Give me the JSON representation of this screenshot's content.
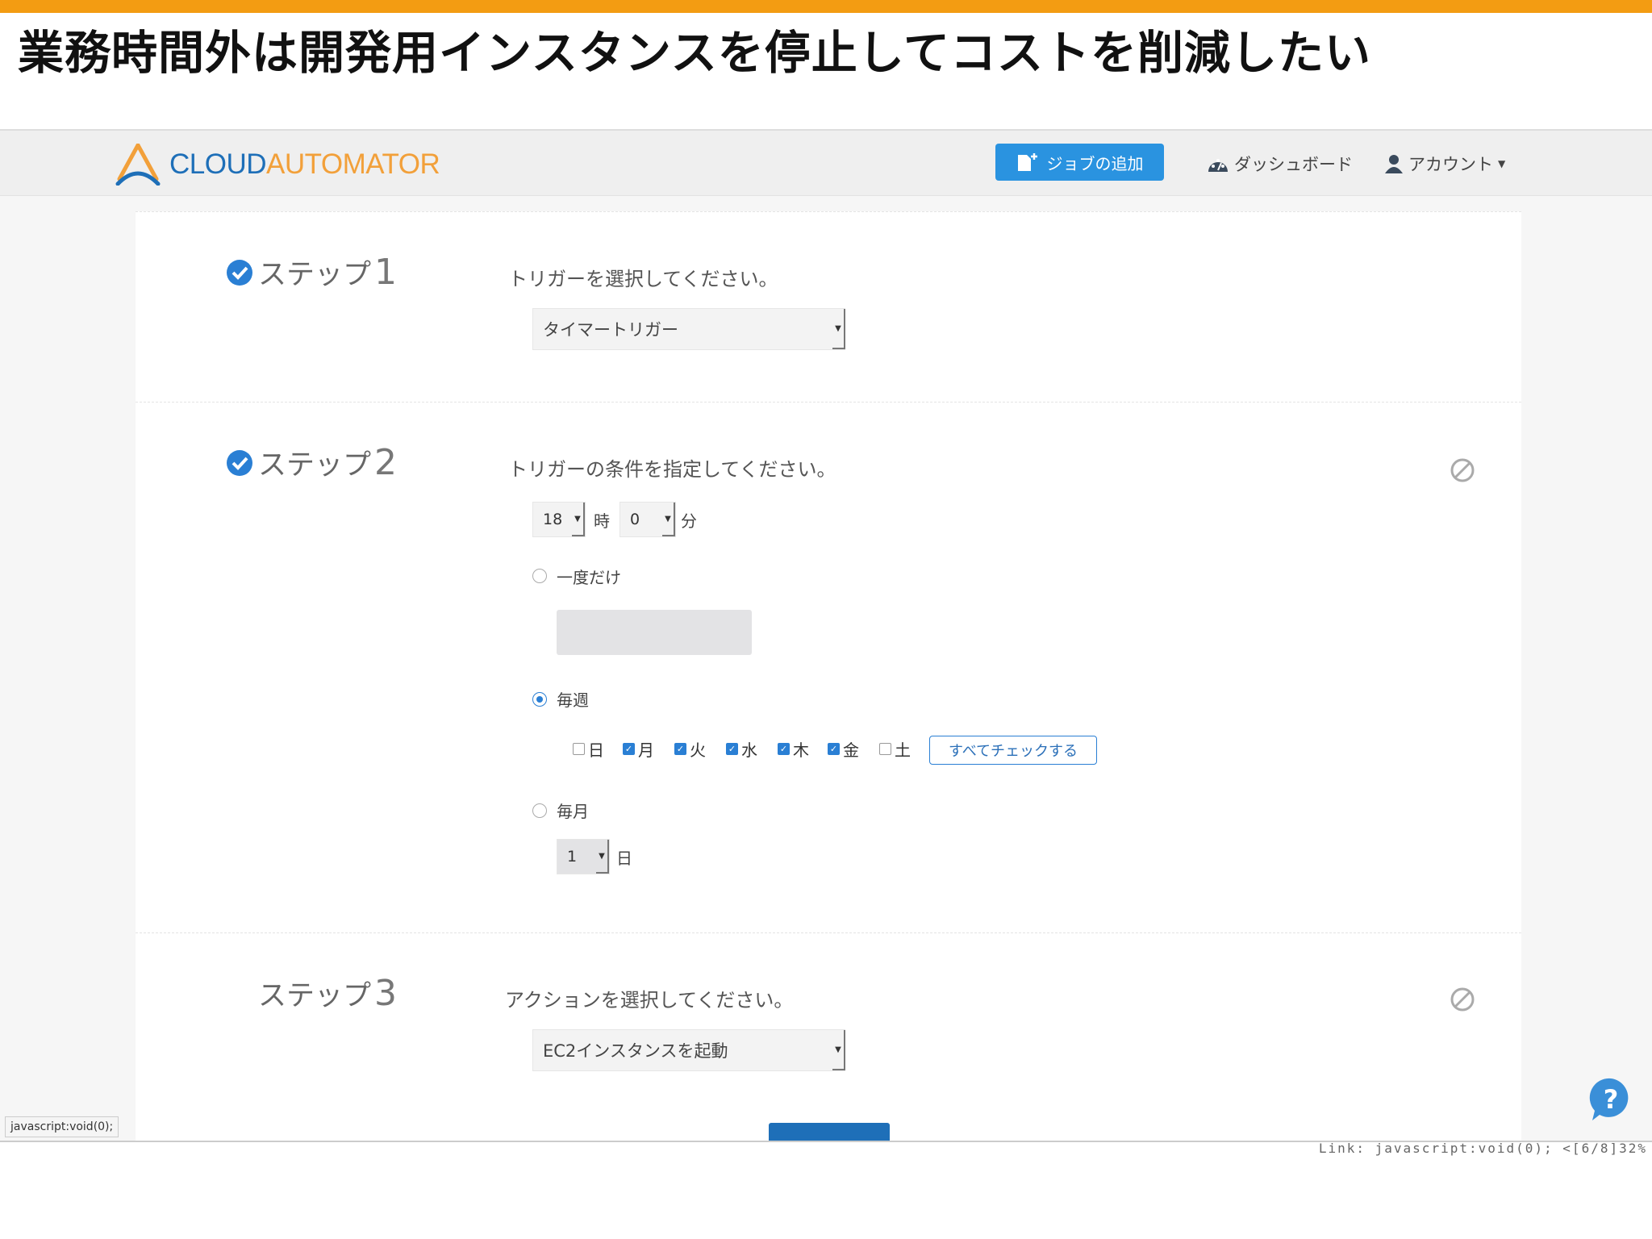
{
  "slide": {
    "title": "業務時間外は開発用インスタンスを停止してコストを削減したい",
    "accent_color": "#f39c12"
  },
  "app": {
    "logo": {
      "part1": "CLOUD",
      "part2": "AUTOMATOR",
      "colors": [
        "#1e6fb8",
        "#f2a03a"
      ]
    },
    "nav": {
      "add_job": "ジョブの追加",
      "dashboard": "ダッシュボード",
      "account": "アカウント"
    },
    "primary_color": "#2a93e0"
  },
  "steps": {
    "step1": {
      "label": "ステップ",
      "number": "1",
      "instruction": "トリガーを選択してください。",
      "trigger_value": "タイマートリガー"
    },
    "step2": {
      "label": "ステップ",
      "number": "2",
      "instruction": "トリガーの条件を指定してください。",
      "hour": "18",
      "hour_unit": "時",
      "minute": "0",
      "minute_unit": "分",
      "once_label": "一度だけ",
      "weekly_label": "毎週",
      "monthly_label": "毎月",
      "days": [
        {
          "label": "日",
          "checked": false
        },
        {
          "label": "月",
          "checked": true
        },
        {
          "label": "火",
          "checked": true
        },
        {
          "label": "水",
          "checked": true
        },
        {
          "label": "木",
          "checked": true
        },
        {
          "label": "金",
          "checked": true
        },
        {
          "label": "土",
          "checked": false
        }
      ],
      "check_all": "すべてチェックする",
      "month_day": "1",
      "month_day_unit": "日"
    },
    "step3": {
      "label": "ステップ",
      "number": "3",
      "instruction": "アクションを選択してください。",
      "action_value": "EC2インスタンスを起動"
    }
  },
  "statusbar": {
    "link_preview": "javascript:void(0);",
    "vim_status": "Link: javascript:void(0); <[6/8]32%"
  }
}
